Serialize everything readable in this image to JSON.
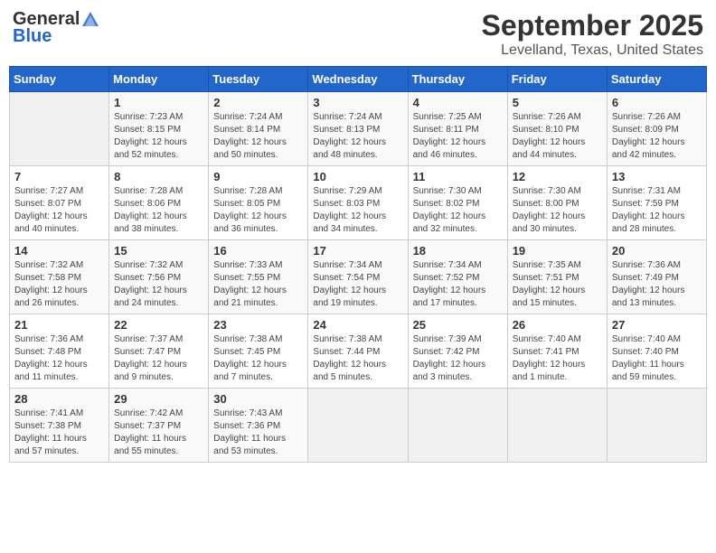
{
  "header": {
    "logo_general": "General",
    "logo_blue": "Blue",
    "month": "September 2025",
    "location": "Levelland, Texas, United States"
  },
  "weekdays": [
    "Sunday",
    "Monday",
    "Tuesday",
    "Wednesday",
    "Thursday",
    "Friday",
    "Saturday"
  ],
  "weeks": [
    [
      {
        "day": "",
        "empty": true
      },
      {
        "day": "1",
        "sunrise": "Sunrise: 7:23 AM",
        "sunset": "Sunset: 8:15 PM",
        "daylight": "Daylight: 12 hours and 52 minutes."
      },
      {
        "day": "2",
        "sunrise": "Sunrise: 7:24 AM",
        "sunset": "Sunset: 8:14 PM",
        "daylight": "Daylight: 12 hours and 50 minutes."
      },
      {
        "day": "3",
        "sunrise": "Sunrise: 7:24 AM",
        "sunset": "Sunset: 8:13 PM",
        "daylight": "Daylight: 12 hours and 48 minutes."
      },
      {
        "day": "4",
        "sunrise": "Sunrise: 7:25 AM",
        "sunset": "Sunset: 8:11 PM",
        "daylight": "Daylight: 12 hours and 46 minutes."
      },
      {
        "day": "5",
        "sunrise": "Sunrise: 7:26 AM",
        "sunset": "Sunset: 8:10 PM",
        "daylight": "Daylight: 12 hours and 44 minutes."
      },
      {
        "day": "6",
        "sunrise": "Sunrise: 7:26 AM",
        "sunset": "Sunset: 8:09 PM",
        "daylight": "Daylight: 12 hours and 42 minutes."
      }
    ],
    [
      {
        "day": "7",
        "sunrise": "Sunrise: 7:27 AM",
        "sunset": "Sunset: 8:07 PM",
        "daylight": "Daylight: 12 hours and 40 minutes."
      },
      {
        "day": "8",
        "sunrise": "Sunrise: 7:28 AM",
        "sunset": "Sunset: 8:06 PM",
        "daylight": "Daylight: 12 hours and 38 minutes."
      },
      {
        "day": "9",
        "sunrise": "Sunrise: 7:28 AM",
        "sunset": "Sunset: 8:05 PM",
        "daylight": "Daylight: 12 hours and 36 minutes."
      },
      {
        "day": "10",
        "sunrise": "Sunrise: 7:29 AM",
        "sunset": "Sunset: 8:03 PM",
        "daylight": "Daylight: 12 hours and 34 minutes."
      },
      {
        "day": "11",
        "sunrise": "Sunrise: 7:30 AM",
        "sunset": "Sunset: 8:02 PM",
        "daylight": "Daylight: 12 hours and 32 minutes."
      },
      {
        "day": "12",
        "sunrise": "Sunrise: 7:30 AM",
        "sunset": "Sunset: 8:00 PM",
        "daylight": "Daylight: 12 hours and 30 minutes."
      },
      {
        "day": "13",
        "sunrise": "Sunrise: 7:31 AM",
        "sunset": "Sunset: 7:59 PM",
        "daylight": "Daylight: 12 hours and 28 minutes."
      }
    ],
    [
      {
        "day": "14",
        "sunrise": "Sunrise: 7:32 AM",
        "sunset": "Sunset: 7:58 PM",
        "daylight": "Daylight: 12 hours and 26 minutes."
      },
      {
        "day": "15",
        "sunrise": "Sunrise: 7:32 AM",
        "sunset": "Sunset: 7:56 PM",
        "daylight": "Daylight: 12 hours and 24 minutes."
      },
      {
        "day": "16",
        "sunrise": "Sunrise: 7:33 AM",
        "sunset": "Sunset: 7:55 PM",
        "daylight": "Daylight: 12 hours and 21 minutes."
      },
      {
        "day": "17",
        "sunrise": "Sunrise: 7:34 AM",
        "sunset": "Sunset: 7:54 PM",
        "daylight": "Daylight: 12 hours and 19 minutes."
      },
      {
        "day": "18",
        "sunrise": "Sunrise: 7:34 AM",
        "sunset": "Sunset: 7:52 PM",
        "daylight": "Daylight: 12 hours and 17 minutes."
      },
      {
        "day": "19",
        "sunrise": "Sunrise: 7:35 AM",
        "sunset": "Sunset: 7:51 PM",
        "daylight": "Daylight: 12 hours and 15 minutes."
      },
      {
        "day": "20",
        "sunrise": "Sunrise: 7:36 AM",
        "sunset": "Sunset: 7:49 PM",
        "daylight": "Daylight: 12 hours and 13 minutes."
      }
    ],
    [
      {
        "day": "21",
        "sunrise": "Sunrise: 7:36 AM",
        "sunset": "Sunset: 7:48 PM",
        "daylight": "Daylight: 12 hours and 11 minutes."
      },
      {
        "day": "22",
        "sunrise": "Sunrise: 7:37 AM",
        "sunset": "Sunset: 7:47 PM",
        "daylight": "Daylight: 12 hours and 9 minutes."
      },
      {
        "day": "23",
        "sunrise": "Sunrise: 7:38 AM",
        "sunset": "Sunset: 7:45 PM",
        "daylight": "Daylight: 12 hours and 7 minutes."
      },
      {
        "day": "24",
        "sunrise": "Sunrise: 7:38 AM",
        "sunset": "Sunset: 7:44 PM",
        "daylight": "Daylight: 12 hours and 5 minutes."
      },
      {
        "day": "25",
        "sunrise": "Sunrise: 7:39 AM",
        "sunset": "Sunset: 7:42 PM",
        "daylight": "Daylight: 12 hours and 3 minutes."
      },
      {
        "day": "26",
        "sunrise": "Sunrise: 7:40 AM",
        "sunset": "Sunset: 7:41 PM",
        "daylight": "Daylight: 12 hours and 1 minute."
      },
      {
        "day": "27",
        "sunrise": "Sunrise: 7:40 AM",
        "sunset": "Sunset: 7:40 PM",
        "daylight": "Daylight: 11 hours and 59 minutes."
      }
    ],
    [
      {
        "day": "28",
        "sunrise": "Sunrise: 7:41 AM",
        "sunset": "Sunset: 7:38 PM",
        "daylight": "Daylight: 11 hours and 57 minutes."
      },
      {
        "day": "29",
        "sunrise": "Sunrise: 7:42 AM",
        "sunset": "Sunset: 7:37 PM",
        "daylight": "Daylight: 11 hours and 55 minutes."
      },
      {
        "day": "30",
        "sunrise": "Sunrise: 7:43 AM",
        "sunset": "Sunset: 7:36 PM",
        "daylight": "Daylight: 11 hours and 53 minutes."
      },
      {
        "day": "",
        "empty": true
      },
      {
        "day": "",
        "empty": true
      },
      {
        "day": "",
        "empty": true
      },
      {
        "day": "",
        "empty": true
      }
    ]
  ]
}
